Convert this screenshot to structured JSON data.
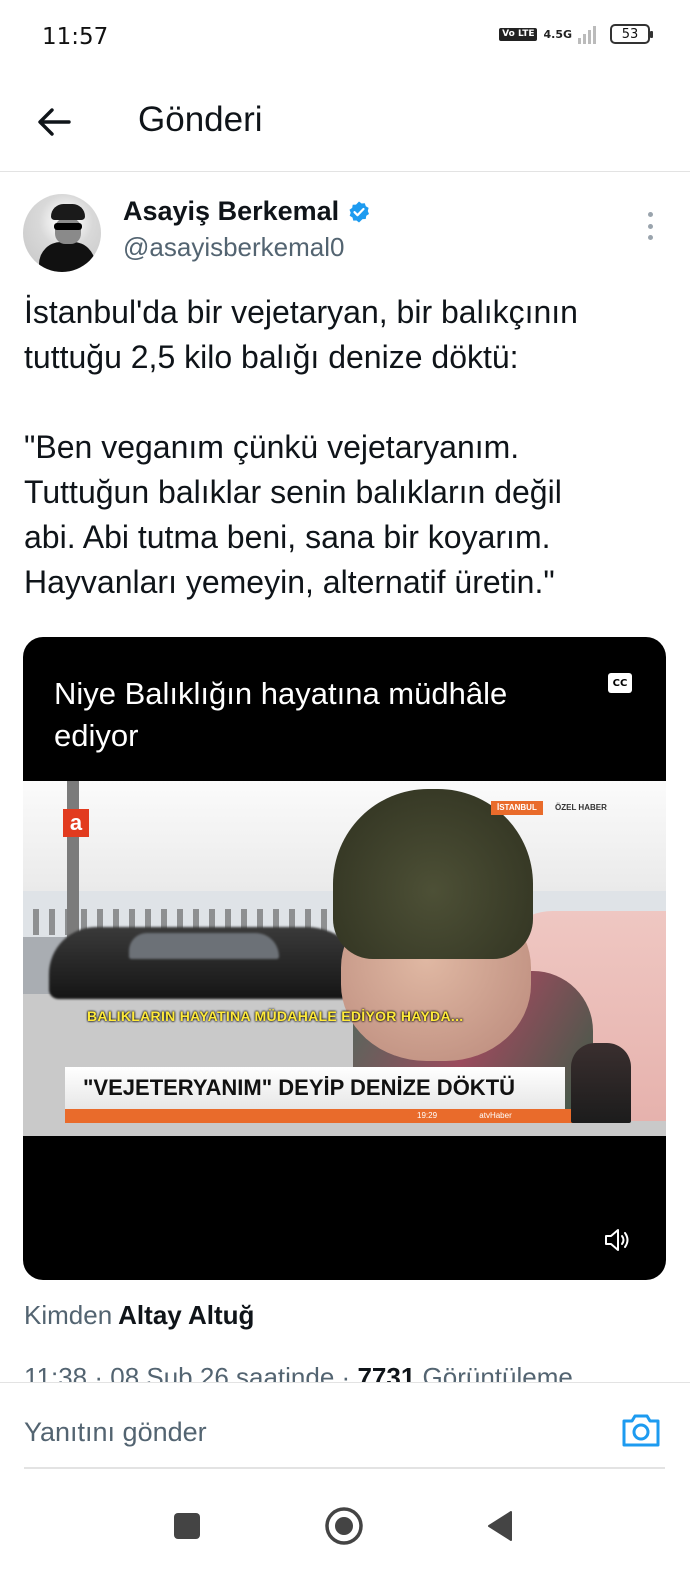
{
  "status_bar": {
    "time": "11:57",
    "volte": "Vo LTE",
    "network": "4.5G",
    "battery": "53"
  },
  "header": {
    "title": "Gönderi"
  },
  "author": {
    "name": "Asayiş Berkemal",
    "handle": "@asayisberkemal0",
    "verified": true
  },
  "tweet": {
    "lines": [
      "İstanbul'da bir vejetaryan, bir balıkçının",
      "tuttuğu 2,5 kilo balığı denize döktü:",
      "",
      "\"Ben veganım çünkü vejetaryanım.",
      "Tuttuğun balıklar senin balıkların değil",
      "abi. Abi tutma beni, sana bir koyarım.",
      "Hayvanları yemeyin, alternatif üretin.\""
    ]
  },
  "video": {
    "caption": "Niye Balıklığın hayatına müdhâle ediyor",
    "cc_label": "CC",
    "frame_logo": "a",
    "frame_tag": "İSTANBUL",
    "frame_tag2": "ÖZEL HABER",
    "frame_subtitle": "BALIKLARIN HAYATINA MÜDAHALE EDİYOR HAYDA...",
    "frame_lower_third": "\"VEJETERYANIM\" DEYİP DENİZE DÖKTÜ",
    "frame_strip_time": "19:29",
    "frame_strip_channel": "atvHaber"
  },
  "source": {
    "prefix": "Kimden",
    "name": "Altay Altuğ"
  },
  "meta": {
    "time_date": "11:38 · 08 Şub 26 saatinde ·",
    "views_count": "7731",
    "views_label": "Görüntüleme"
  },
  "reply": {
    "placeholder": "Yanıtını gönder"
  },
  "colors": {
    "accent": "#1d9bf0",
    "text": "#0f1419",
    "muted": "#536471",
    "divider": "#e3e3e3"
  }
}
